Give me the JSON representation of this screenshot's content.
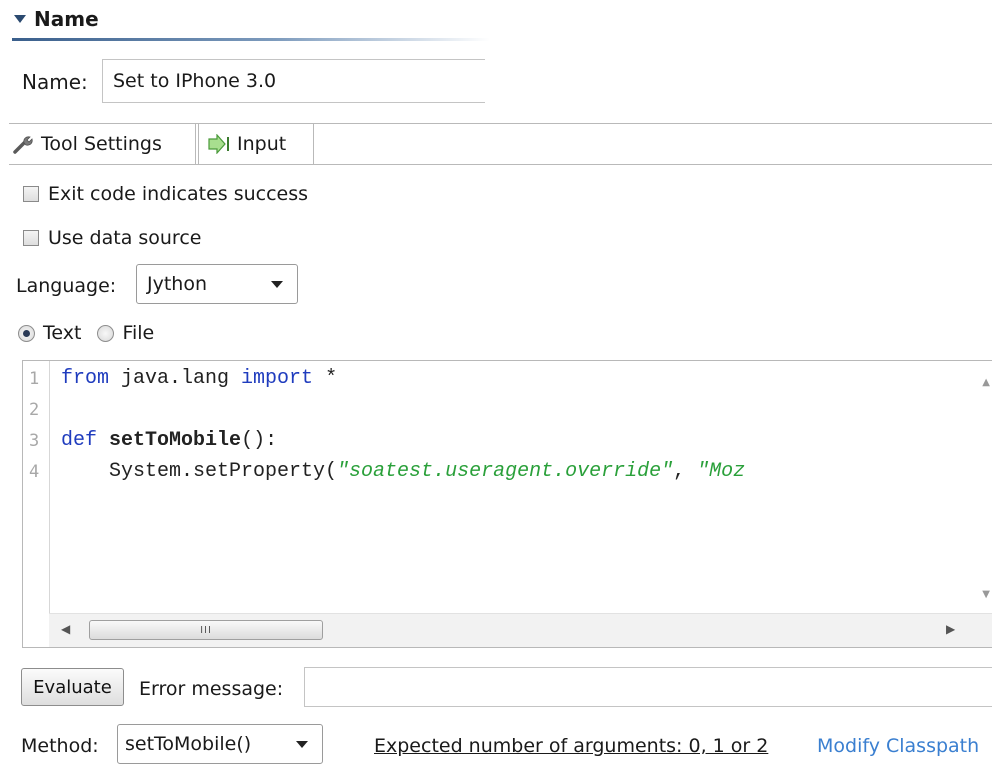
{
  "section": {
    "title": "Name"
  },
  "name": {
    "label": "Name:",
    "value": "Set to IPhone 3.0"
  },
  "tabs": [
    {
      "label": "Tool Settings",
      "icon": "wrench-icon",
      "active": true
    },
    {
      "label": "Input",
      "icon": "green-arrow-icon",
      "active": false
    }
  ],
  "options": {
    "exit_code": {
      "label": "Exit code indicates success",
      "checked": false
    },
    "use_data_source": {
      "label": "Use data source",
      "checked": false
    }
  },
  "language": {
    "label": "Language:",
    "value": "Jython"
  },
  "source_mode": {
    "text_label": "Text",
    "file_label": "File",
    "selected": "Text"
  },
  "editor": {
    "line_numbers": [
      "1",
      "2",
      "3",
      "4"
    ],
    "lines": {
      "l1_kw1": "from",
      "l1_mid": " java.lang ",
      "l1_kw2": "import",
      "l1_end": " *",
      "l3_kw": "def",
      "l3_fn": "setToMobile",
      "l3_end": "():",
      "l4_call": "    System.setProperty(",
      "l4_str1": "\"soatest.useragent.override\"",
      "l4_sep": ", ",
      "l4_str2": "\"Moz"
    },
    "scrollbar_grip": "III"
  },
  "evaluate": {
    "button_label": "Evaluate",
    "error_label": "Error message:",
    "error_value": ""
  },
  "method": {
    "label": "Method:",
    "value": "setToMobile()",
    "expected_args": "Expected number of arguments: 0, 1 or 2",
    "modify_classpath": "Modify Classpath"
  },
  "colors": {
    "keyword": "#1f3cbe",
    "string": "#2aa03a",
    "link": "#3a7fd0",
    "section_rule": "#3a5f8c"
  }
}
